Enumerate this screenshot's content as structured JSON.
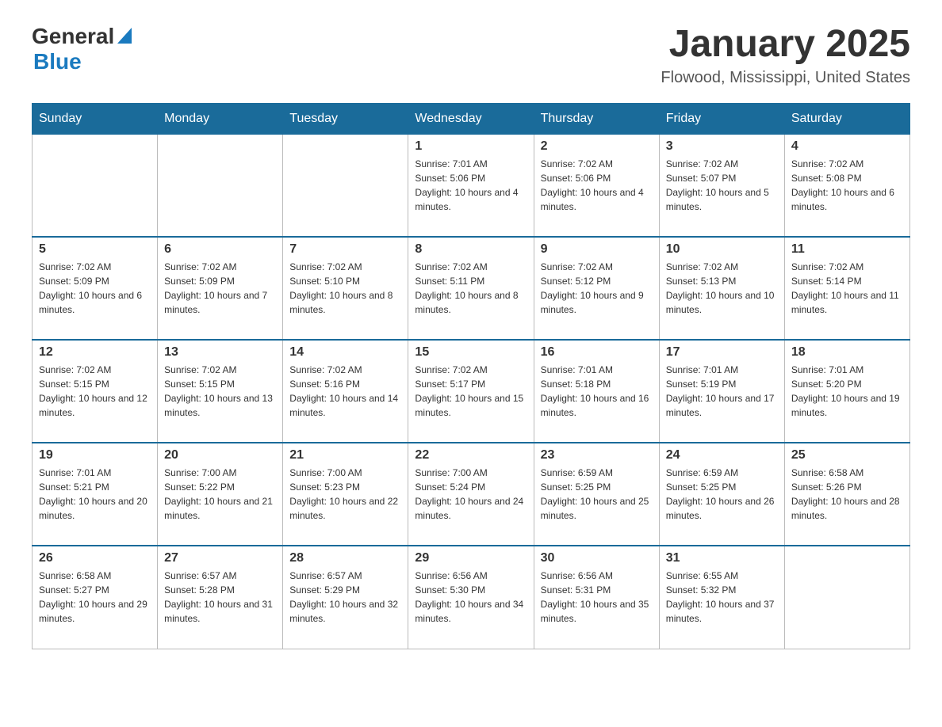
{
  "header": {
    "logo": {
      "general": "General",
      "blue": "Blue"
    },
    "title": "January 2025",
    "location": "Flowood, Mississippi, United States"
  },
  "calendar": {
    "days_of_week": [
      "Sunday",
      "Monday",
      "Tuesday",
      "Wednesday",
      "Thursday",
      "Friday",
      "Saturday"
    ],
    "weeks": [
      [
        {
          "day": "",
          "info": ""
        },
        {
          "day": "",
          "info": ""
        },
        {
          "day": "",
          "info": ""
        },
        {
          "day": "1",
          "info": "Sunrise: 7:01 AM\nSunset: 5:06 PM\nDaylight: 10 hours and 4 minutes."
        },
        {
          "day": "2",
          "info": "Sunrise: 7:02 AM\nSunset: 5:06 PM\nDaylight: 10 hours and 4 minutes."
        },
        {
          "day": "3",
          "info": "Sunrise: 7:02 AM\nSunset: 5:07 PM\nDaylight: 10 hours and 5 minutes."
        },
        {
          "day": "4",
          "info": "Sunrise: 7:02 AM\nSunset: 5:08 PM\nDaylight: 10 hours and 6 minutes."
        }
      ],
      [
        {
          "day": "5",
          "info": "Sunrise: 7:02 AM\nSunset: 5:09 PM\nDaylight: 10 hours and 6 minutes."
        },
        {
          "day": "6",
          "info": "Sunrise: 7:02 AM\nSunset: 5:09 PM\nDaylight: 10 hours and 7 minutes."
        },
        {
          "day": "7",
          "info": "Sunrise: 7:02 AM\nSunset: 5:10 PM\nDaylight: 10 hours and 8 minutes."
        },
        {
          "day": "8",
          "info": "Sunrise: 7:02 AM\nSunset: 5:11 PM\nDaylight: 10 hours and 8 minutes."
        },
        {
          "day": "9",
          "info": "Sunrise: 7:02 AM\nSunset: 5:12 PM\nDaylight: 10 hours and 9 minutes."
        },
        {
          "day": "10",
          "info": "Sunrise: 7:02 AM\nSunset: 5:13 PM\nDaylight: 10 hours and 10 minutes."
        },
        {
          "day": "11",
          "info": "Sunrise: 7:02 AM\nSunset: 5:14 PM\nDaylight: 10 hours and 11 minutes."
        }
      ],
      [
        {
          "day": "12",
          "info": "Sunrise: 7:02 AM\nSunset: 5:15 PM\nDaylight: 10 hours and 12 minutes."
        },
        {
          "day": "13",
          "info": "Sunrise: 7:02 AM\nSunset: 5:15 PM\nDaylight: 10 hours and 13 minutes."
        },
        {
          "day": "14",
          "info": "Sunrise: 7:02 AM\nSunset: 5:16 PM\nDaylight: 10 hours and 14 minutes."
        },
        {
          "day": "15",
          "info": "Sunrise: 7:02 AM\nSunset: 5:17 PM\nDaylight: 10 hours and 15 minutes."
        },
        {
          "day": "16",
          "info": "Sunrise: 7:01 AM\nSunset: 5:18 PM\nDaylight: 10 hours and 16 minutes."
        },
        {
          "day": "17",
          "info": "Sunrise: 7:01 AM\nSunset: 5:19 PM\nDaylight: 10 hours and 17 minutes."
        },
        {
          "day": "18",
          "info": "Sunrise: 7:01 AM\nSunset: 5:20 PM\nDaylight: 10 hours and 19 minutes."
        }
      ],
      [
        {
          "day": "19",
          "info": "Sunrise: 7:01 AM\nSunset: 5:21 PM\nDaylight: 10 hours and 20 minutes."
        },
        {
          "day": "20",
          "info": "Sunrise: 7:00 AM\nSunset: 5:22 PM\nDaylight: 10 hours and 21 minutes."
        },
        {
          "day": "21",
          "info": "Sunrise: 7:00 AM\nSunset: 5:23 PM\nDaylight: 10 hours and 22 minutes."
        },
        {
          "day": "22",
          "info": "Sunrise: 7:00 AM\nSunset: 5:24 PM\nDaylight: 10 hours and 24 minutes."
        },
        {
          "day": "23",
          "info": "Sunrise: 6:59 AM\nSunset: 5:25 PM\nDaylight: 10 hours and 25 minutes."
        },
        {
          "day": "24",
          "info": "Sunrise: 6:59 AM\nSunset: 5:25 PM\nDaylight: 10 hours and 26 minutes."
        },
        {
          "day": "25",
          "info": "Sunrise: 6:58 AM\nSunset: 5:26 PM\nDaylight: 10 hours and 28 minutes."
        }
      ],
      [
        {
          "day": "26",
          "info": "Sunrise: 6:58 AM\nSunset: 5:27 PM\nDaylight: 10 hours and 29 minutes."
        },
        {
          "day": "27",
          "info": "Sunrise: 6:57 AM\nSunset: 5:28 PM\nDaylight: 10 hours and 31 minutes."
        },
        {
          "day": "28",
          "info": "Sunrise: 6:57 AM\nSunset: 5:29 PM\nDaylight: 10 hours and 32 minutes."
        },
        {
          "day": "29",
          "info": "Sunrise: 6:56 AM\nSunset: 5:30 PM\nDaylight: 10 hours and 34 minutes."
        },
        {
          "day": "30",
          "info": "Sunrise: 6:56 AM\nSunset: 5:31 PM\nDaylight: 10 hours and 35 minutes."
        },
        {
          "day": "31",
          "info": "Sunrise: 6:55 AM\nSunset: 5:32 PM\nDaylight: 10 hours and 37 minutes."
        },
        {
          "day": "",
          "info": ""
        }
      ]
    ]
  }
}
